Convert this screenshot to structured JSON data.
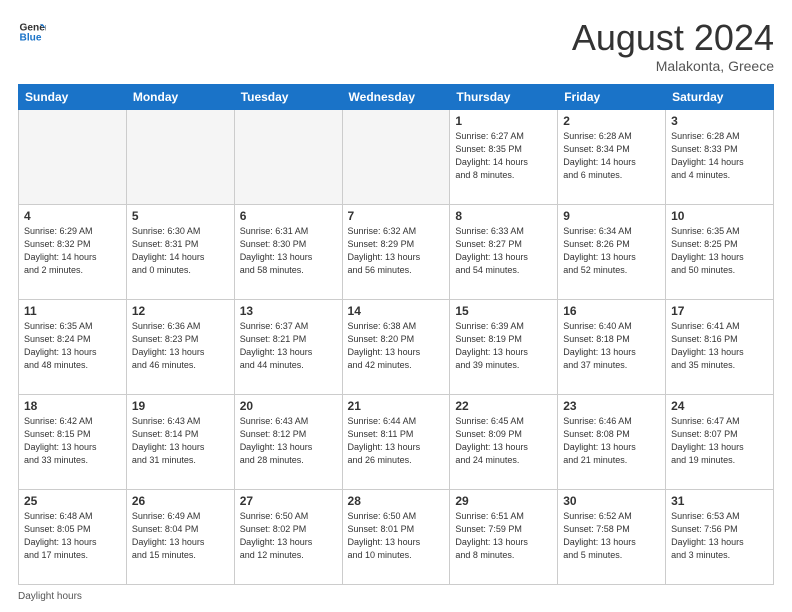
{
  "logo": {
    "line1": "General",
    "line2": "Blue"
  },
  "title": "August 2024",
  "subtitle": "Malakonta, Greece",
  "days_of_week": [
    "Sunday",
    "Monday",
    "Tuesday",
    "Wednesday",
    "Thursday",
    "Friday",
    "Saturday"
  ],
  "weeks": [
    [
      {
        "num": "",
        "info": ""
      },
      {
        "num": "",
        "info": ""
      },
      {
        "num": "",
        "info": ""
      },
      {
        "num": "",
        "info": ""
      },
      {
        "num": "1",
        "info": "Sunrise: 6:27 AM\nSunset: 8:35 PM\nDaylight: 14 hours\nand 8 minutes."
      },
      {
        "num": "2",
        "info": "Sunrise: 6:28 AM\nSunset: 8:34 PM\nDaylight: 14 hours\nand 6 minutes."
      },
      {
        "num": "3",
        "info": "Sunrise: 6:28 AM\nSunset: 8:33 PM\nDaylight: 14 hours\nand 4 minutes."
      }
    ],
    [
      {
        "num": "4",
        "info": "Sunrise: 6:29 AM\nSunset: 8:32 PM\nDaylight: 14 hours\nand 2 minutes."
      },
      {
        "num": "5",
        "info": "Sunrise: 6:30 AM\nSunset: 8:31 PM\nDaylight: 14 hours\nand 0 minutes."
      },
      {
        "num": "6",
        "info": "Sunrise: 6:31 AM\nSunset: 8:30 PM\nDaylight: 13 hours\nand 58 minutes."
      },
      {
        "num": "7",
        "info": "Sunrise: 6:32 AM\nSunset: 8:29 PM\nDaylight: 13 hours\nand 56 minutes."
      },
      {
        "num": "8",
        "info": "Sunrise: 6:33 AM\nSunset: 8:27 PM\nDaylight: 13 hours\nand 54 minutes."
      },
      {
        "num": "9",
        "info": "Sunrise: 6:34 AM\nSunset: 8:26 PM\nDaylight: 13 hours\nand 52 minutes."
      },
      {
        "num": "10",
        "info": "Sunrise: 6:35 AM\nSunset: 8:25 PM\nDaylight: 13 hours\nand 50 minutes."
      }
    ],
    [
      {
        "num": "11",
        "info": "Sunrise: 6:35 AM\nSunset: 8:24 PM\nDaylight: 13 hours\nand 48 minutes."
      },
      {
        "num": "12",
        "info": "Sunrise: 6:36 AM\nSunset: 8:23 PM\nDaylight: 13 hours\nand 46 minutes."
      },
      {
        "num": "13",
        "info": "Sunrise: 6:37 AM\nSunset: 8:21 PM\nDaylight: 13 hours\nand 44 minutes."
      },
      {
        "num": "14",
        "info": "Sunrise: 6:38 AM\nSunset: 8:20 PM\nDaylight: 13 hours\nand 42 minutes."
      },
      {
        "num": "15",
        "info": "Sunrise: 6:39 AM\nSunset: 8:19 PM\nDaylight: 13 hours\nand 39 minutes."
      },
      {
        "num": "16",
        "info": "Sunrise: 6:40 AM\nSunset: 8:18 PM\nDaylight: 13 hours\nand 37 minutes."
      },
      {
        "num": "17",
        "info": "Sunrise: 6:41 AM\nSunset: 8:16 PM\nDaylight: 13 hours\nand 35 minutes."
      }
    ],
    [
      {
        "num": "18",
        "info": "Sunrise: 6:42 AM\nSunset: 8:15 PM\nDaylight: 13 hours\nand 33 minutes."
      },
      {
        "num": "19",
        "info": "Sunrise: 6:43 AM\nSunset: 8:14 PM\nDaylight: 13 hours\nand 31 minutes."
      },
      {
        "num": "20",
        "info": "Sunrise: 6:43 AM\nSunset: 8:12 PM\nDaylight: 13 hours\nand 28 minutes."
      },
      {
        "num": "21",
        "info": "Sunrise: 6:44 AM\nSunset: 8:11 PM\nDaylight: 13 hours\nand 26 minutes."
      },
      {
        "num": "22",
        "info": "Sunrise: 6:45 AM\nSunset: 8:09 PM\nDaylight: 13 hours\nand 24 minutes."
      },
      {
        "num": "23",
        "info": "Sunrise: 6:46 AM\nSunset: 8:08 PM\nDaylight: 13 hours\nand 21 minutes."
      },
      {
        "num": "24",
        "info": "Sunrise: 6:47 AM\nSunset: 8:07 PM\nDaylight: 13 hours\nand 19 minutes."
      }
    ],
    [
      {
        "num": "25",
        "info": "Sunrise: 6:48 AM\nSunset: 8:05 PM\nDaylight: 13 hours\nand 17 minutes."
      },
      {
        "num": "26",
        "info": "Sunrise: 6:49 AM\nSunset: 8:04 PM\nDaylight: 13 hours\nand 15 minutes."
      },
      {
        "num": "27",
        "info": "Sunrise: 6:50 AM\nSunset: 8:02 PM\nDaylight: 13 hours\nand 12 minutes."
      },
      {
        "num": "28",
        "info": "Sunrise: 6:50 AM\nSunset: 8:01 PM\nDaylight: 13 hours\nand 10 minutes."
      },
      {
        "num": "29",
        "info": "Sunrise: 6:51 AM\nSunset: 7:59 PM\nDaylight: 13 hours\nand 8 minutes."
      },
      {
        "num": "30",
        "info": "Sunrise: 6:52 AM\nSunset: 7:58 PM\nDaylight: 13 hours\nand 5 minutes."
      },
      {
        "num": "31",
        "info": "Sunrise: 6:53 AM\nSunset: 7:56 PM\nDaylight: 13 hours\nand 3 minutes."
      }
    ]
  ],
  "footer": {
    "label": "Daylight hours"
  },
  "colors": {
    "header_bg": "#1a73c8",
    "accent": "#1a73c8"
  }
}
